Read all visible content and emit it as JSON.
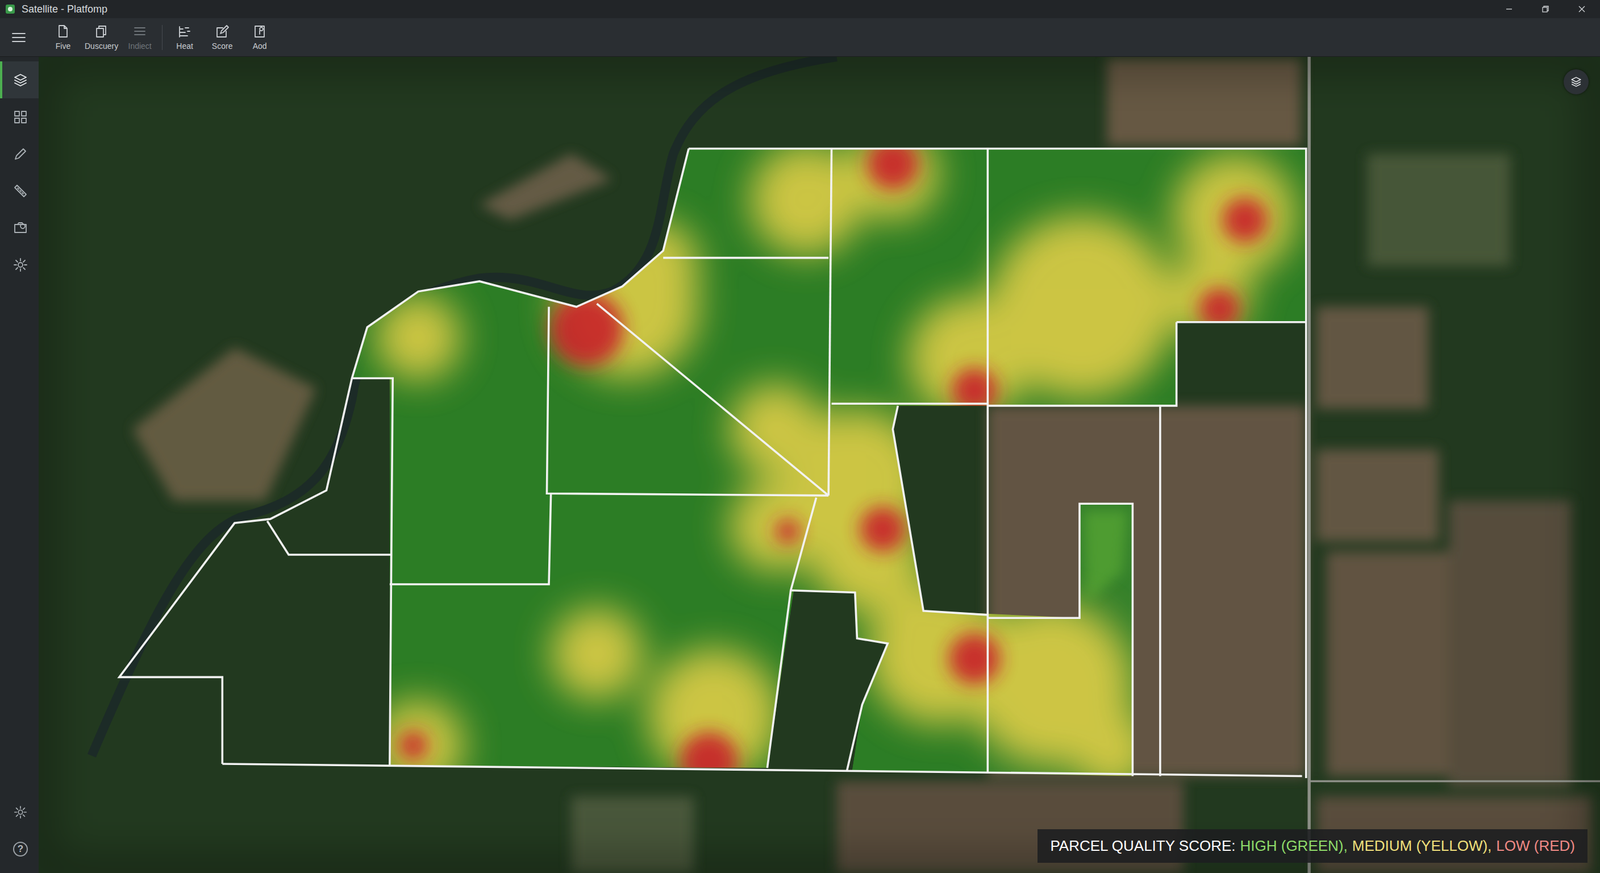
{
  "window": {
    "title": "Satellite - Platfomp"
  },
  "toolbar": {
    "items": [
      {
        "label": "Five",
        "disabled": false
      },
      {
        "label": "Duscuery",
        "disabled": false
      },
      {
        "label": "Indiect",
        "disabled": true
      },
      {
        "label": "Heat",
        "disabled": false
      },
      {
        "label": "Score",
        "disabled": false
      },
      {
        "label": "Aod",
        "disabled": false
      }
    ]
  },
  "sidebar": {
    "items": [
      {
        "selected": true
      },
      {
        "selected": false
      },
      {
        "selected": false
      },
      {
        "selected": false
      },
      {
        "selected": false
      },
      {
        "selected": false
      }
    ],
    "help": {
      "label": "?"
    }
  },
  "map": {
    "legend": {
      "title": "PARCEL QUALITY SCORE:",
      "items": [
        {
          "label": "HIGH (GREEN),",
          "color": "#8fdc6a"
        },
        {
          "label": "MEDIUM (YELLOW),",
          "color": "#f1e07c"
        },
        {
          "label": "LOW (RED)",
          "color": "#f08a86"
        }
      ]
    }
  }
}
